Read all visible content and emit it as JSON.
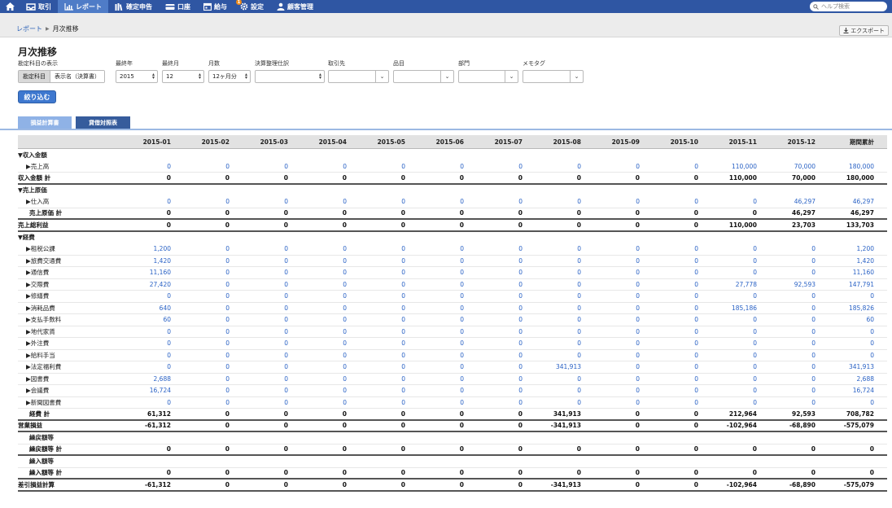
{
  "nav": {
    "items": [
      {
        "label": "取引",
        "icon": "inbox-icon"
      },
      {
        "label": "レポート",
        "icon": "chart-icon"
      },
      {
        "label": "確定申告",
        "icon": "books-icon"
      },
      {
        "label": "口座",
        "icon": "card-icon"
      },
      {
        "label": "給与",
        "icon": "calendar-icon"
      },
      {
        "label": "設定",
        "icon": "gear-icon",
        "badge": "1"
      },
      {
        "label": "顧客管理",
        "icon": "person-icon"
      }
    ],
    "help_placeholder": "ヘルプ検索",
    "active_color": "#4f7cc7",
    "bar_color": "#2f56a3"
  },
  "breadcrumb": {
    "parent": "レポート",
    "current": "月次推移"
  },
  "export_label": "エクスポート",
  "title": "月次推移",
  "filters": {
    "account_display_label": "勘定科目の表示",
    "account_options": [
      "勘定科目",
      "表示名（決算書）"
    ],
    "end_year_label": "最終年",
    "end_year": "2015",
    "end_month_label": "最終月",
    "end_month": "12",
    "months_label": "月数",
    "months": "12ヶ月分",
    "closing_label": "決算整理仕訳",
    "closing": "",
    "partner_label": "取引先",
    "item_label": "品目",
    "dept_label": "部門",
    "memo_label": "メモタグ",
    "apply_label": "絞り込む"
  },
  "tabs": {
    "pl": "損益計算書",
    "bs": "貸借対照表"
  },
  "table": {
    "headers": [
      "",
      "2015-01",
      "2015-02",
      "2015-03",
      "2015-04",
      "2015-05",
      "2015-06",
      "2015-07",
      "2015-08",
      "2015-09",
      "2015-10",
      "2015-11",
      "2015-12",
      "期間累計"
    ],
    "rows": [
      {
        "type": "group",
        "cells": [
          "▼収入金額",
          "",
          "",
          "",
          "",
          "",
          "",
          "",
          "",
          "",
          "",
          "",
          "",
          ""
        ]
      },
      {
        "type": "item",
        "cells": [
          "▶売上高",
          "0",
          "0",
          "0",
          "0",
          "0",
          "0",
          "0",
          "0",
          "0",
          "0",
          "110,000",
          "70,000",
          "180,000"
        ]
      },
      {
        "type": "total",
        "cells": [
          "収入金額 計",
          "0",
          "0",
          "0",
          "0",
          "0",
          "0",
          "0",
          "0",
          "0",
          "0",
          "110,000",
          "70,000",
          "180,000"
        ]
      },
      {
        "type": "group",
        "cells": [
          "▼売上原価",
          "",
          "",
          "",
          "",
          "",
          "",
          "",
          "",
          "",
          "",
          "",
          "",
          ""
        ]
      },
      {
        "type": "item",
        "cells": [
          "▶仕入高",
          "0",
          "0",
          "0",
          "0",
          "0",
          "0",
          "0",
          "0",
          "0",
          "0",
          "0",
          "46,297",
          "46,297"
        ]
      },
      {
        "type": "total indent",
        "cells": [
          "売上原価 計",
          "0",
          "0",
          "0",
          "0",
          "0",
          "0",
          "0",
          "0",
          "0",
          "0",
          "0",
          "46,297",
          "46,297"
        ]
      },
      {
        "type": "total",
        "cells": [
          "売上総利益",
          "0",
          "0",
          "0",
          "0",
          "0",
          "0",
          "0",
          "0",
          "0",
          "0",
          "110,000",
          "23,703",
          "133,703"
        ]
      },
      {
        "type": "group",
        "cells": [
          "▼経費",
          "",
          "",
          "",
          "",
          "",
          "",
          "",
          "",
          "",
          "",
          "",
          "",
          ""
        ]
      },
      {
        "type": "item",
        "cells": [
          "▶租税公課",
          "1,200",
          "0",
          "0",
          "0",
          "0",
          "0",
          "0",
          "0",
          "0",
          "0",
          "0",
          "0",
          "1,200"
        ]
      },
      {
        "type": "item",
        "cells": [
          "▶旅費交通費",
          "1,420",
          "0",
          "0",
          "0",
          "0",
          "0",
          "0",
          "0",
          "0",
          "0",
          "0",
          "0",
          "1,420"
        ]
      },
      {
        "type": "item",
        "cells": [
          "▶通信費",
          "11,160",
          "0",
          "0",
          "0",
          "0",
          "0",
          "0",
          "0",
          "0",
          "0",
          "0",
          "0",
          "11,160"
        ]
      },
      {
        "type": "item",
        "cells": [
          "▶交際費",
          "27,420",
          "0",
          "0",
          "0",
          "0",
          "0",
          "0",
          "0",
          "0",
          "0",
          "27,778",
          "92,593",
          "147,791"
        ]
      },
      {
        "type": "item",
        "cells": [
          "▶修繕費",
          "0",
          "0",
          "0",
          "0",
          "0",
          "0",
          "0",
          "0",
          "0",
          "0",
          "0",
          "0",
          "0"
        ]
      },
      {
        "type": "item",
        "cells": [
          "▶消耗品費",
          "640",
          "0",
          "0",
          "0",
          "0",
          "0",
          "0",
          "0",
          "0",
          "0",
          "185,186",
          "0",
          "185,826"
        ]
      },
      {
        "type": "item",
        "cells": [
          "▶支払手数料",
          "60",
          "0",
          "0",
          "0",
          "0",
          "0",
          "0",
          "0",
          "0",
          "0",
          "0",
          "0",
          "60"
        ]
      },
      {
        "type": "item",
        "cells": [
          "▶地代家賃",
          "0",
          "0",
          "0",
          "0",
          "0",
          "0",
          "0",
          "0",
          "0",
          "0",
          "0",
          "0",
          "0"
        ]
      },
      {
        "type": "item",
        "cells": [
          "▶外注費",
          "0",
          "0",
          "0",
          "0",
          "0",
          "0",
          "0",
          "0",
          "0",
          "0",
          "0",
          "0",
          "0"
        ]
      },
      {
        "type": "item",
        "cells": [
          "▶給料手当",
          "0",
          "0",
          "0",
          "0",
          "0",
          "0",
          "0",
          "0",
          "0",
          "0",
          "0",
          "0",
          "0"
        ]
      },
      {
        "type": "item",
        "cells": [
          "▶法定福利費",
          "0",
          "0",
          "0",
          "0",
          "0",
          "0",
          "0",
          "341,913",
          "0",
          "0",
          "0",
          "0",
          "341,913"
        ]
      },
      {
        "type": "item",
        "cells": [
          "▶図書費",
          "2,688",
          "0",
          "0",
          "0",
          "0",
          "0",
          "0",
          "0",
          "0",
          "0",
          "0",
          "0",
          "2,688"
        ]
      },
      {
        "type": "item",
        "cells": [
          "▶会議費",
          "16,724",
          "0",
          "0",
          "0",
          "0",
          "0",
          "0",
          "0",
          "0",
          "0",
          "0",
          "0",
          "16,724"
        ]
      },
      {
        "type": "item",
        "cells": [
          "▶新聞図書費",
          "0",
          "0",
          "0",
          "0",
          "0",
          "0",
          "0",
          "0",
          "0",
          "0",
          "0",
          "0",
          "0"
        ]
      },
      {
        "type": "total indent",
        "cells": [
          "経費 計",
          "61,312",
          "0",
          "0",
          "0",
          "0",
          "0",
          "0",
          "341,913",
          "0",
          "0",
          "212,964",
          "92,593",
          "708,782"
        ]
      },
      {
        "type": "total",
        "cells": [
          "営業損益",
          "-61,312",
          "0",
          "0",
          "0",
          "0",
          "0",
          "0",
          "-341,913",
          "0",
          "0",
          "-102,964",
          "-68,890",
          "-575,079"
        ]
      },
      {
        "type": "sub",
        "cells": [
          "繰戻額等",
          "",
          "",
          "",
          "",
          "",
          "",
          "",
          "",
          "",
          "",
          "",
          "",
          ""
        ]
      },
      {
        "type": "total indent",
        "cells": [
          "繰戻額等 計",
          "0",
          "0",
          "0",
          "0",
          "0",
          "0",
          "0",
          "0",
          "0",
          "0",
          "0",
          "0",
          "0"
        ]
      },
      {
        "type": "sub",
        "cells": [
          "繰入額等",
          "",
          "",
          "",
          "",
          "",
          "",
          "",
          "",
          "",
          "",
          "",
          "",
          ""
        ]
      },
      {
        "type": "total indent",
        "cells": [
          "繰入額等 計",
          "0",
          "0",
          "0",
          "0",
          "0",
          "0",
          "0",
          "0",
          "0",
          "0",
          "0",
          "0",
          "0"
        ]
      },
      {
        "type": "total",
        "cells": [
          "差引損益計算",
          "-61,312",
          "0",
          "0",
          "0",
          "0",
          "0",
          "0",
          "-341,913",
          "0",
          "0",
          "-102,964",
          "-68,890",
          "-575,079"
        ]
      }
    ]
  }
}
